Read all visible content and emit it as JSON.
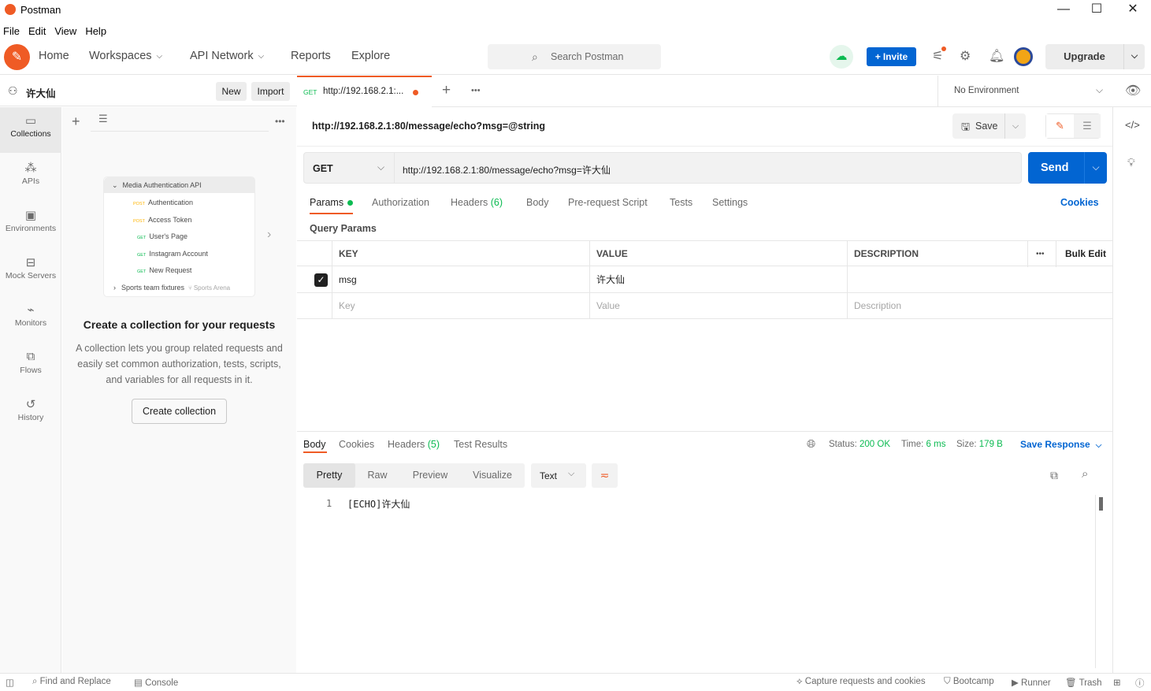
{
  "window": {
    "title": "Postman"
  },
  "menu": [
    "File",
    "Edit",
    "View",
    "Help"
  ],
  "nav": {
    "home": "Home",
    "workspaces": "Workspaces",
    "api_network": "API Network",
    "reports": "Reports",
    "explore": "Explore"
  },
  "search": {
    "placeholder": "Search Postman"
  },
  "header": {
    "invite": "Invite",
    "upgrade": "Upgrade"
  },
  "sidebar": {
    "user": "许大仙",
    "new": "New",
    "import": "Import",
    "rail": [
      "Collections",
      "APIs",
      "Environments",
      "Mock Servers",
      "Monitors",
      "Flows",
      "History"
    ],
    "illustration": {
      "collection": "Media Authentication API",
      "requests": [
        {
          "method": "POST",
          "name": "Authentication"
        },
        {
          "method": "POST",
          "name": "Access Token"
        },
        {
          "method": "GET",
          "name": "User's Page"
        },
        {
          "method": "GET",
          "name": "Instagram Account"
        },
        {
          "method": "GET",
          "name": "New Request"
        }
      ],
      "other": "Sports team fixtures",
      "other_ws": "Sports Arena"
    },
    "empty_title": "Create a collection for your requests",
    "empty_body": [
      "A collection lets you group related requests and",
      "easily set common authorization, tests, scripts,",
      "and variables for all requests in it."
    ],
    "create_button": "Create collection"
  },
  "tab": {
    "method": "GET",
    "label": "http://192.168.2.1:..."
  },
  "environment": "No Environment",
  "request": {
    "title": "http://192.168.2.1:80/message/echo?msg=@string",
    "save": "Save",
    "method": "GET",
    "url": "http://192.168.2.1:80/message/echo?msg=许大仙",
    "send": "Send",
    "tabs": {
      "params": "Params",
      "authorization": "Authorization",
      "headers": "Headers",
      "headers_count": "(6)",
      "body": "Body",
      "prerequest": "Pre-request Script",
      "tests": "Tests",
      "settings": "Settings",
      "cookies": "Cookies"
    },
    "query_params_label": "Query Params",
    "table": {
      "headers": {
        "key": "KEY",
        "value": "VALUE",
        "description": "DESCRIPTION",
        "bulk": "Bulk Edit"
      },
      "rows": [
        {
          "key": "msg",
          "value": "许大仙",
          "description": "",
          "checked": true
        }
      ],
      "placeholder": {
        "key": "Key",
        "value": "Value",
        "description": "Description"
      }
    }
  },
  "response": {
    "tabs": {
      "body": "Body",
      "cookies": "Cookies",
      "headers": "Headers",
      "headers_count": "(5)",
      "tests": "Test Results"
    },
    "status_label": "Status:",
    "status": "200 OK",
    "time_label": "Time:",
    "time": "6 ms",
    "size_label": "Size:",
    "size": "179 B",
    "save_response": "Save Response",
    "views": [
      "Pretty",
      "Raw",
      "Preview",
      "Visualize"
    ],
    "format": "Text",
    "line_no": "1",
    "body": "[ECHO]许大仙"
  },
  "statusbar": {
    "find": "Find and Replace",
    "console": "Console",
    "capture": "Capture requests and cookies",
    "bootcamp": "Bootcamp",
    "runner": "Runner",
    "trash": "Trash"
  },
  "colors": {
    "brand": "#ef5b25",
    "primary": "#0265d2",
    "success": "#0cbb52",
    "get": "#0cbb52",
    "post": "#ffb400"
  }
}
